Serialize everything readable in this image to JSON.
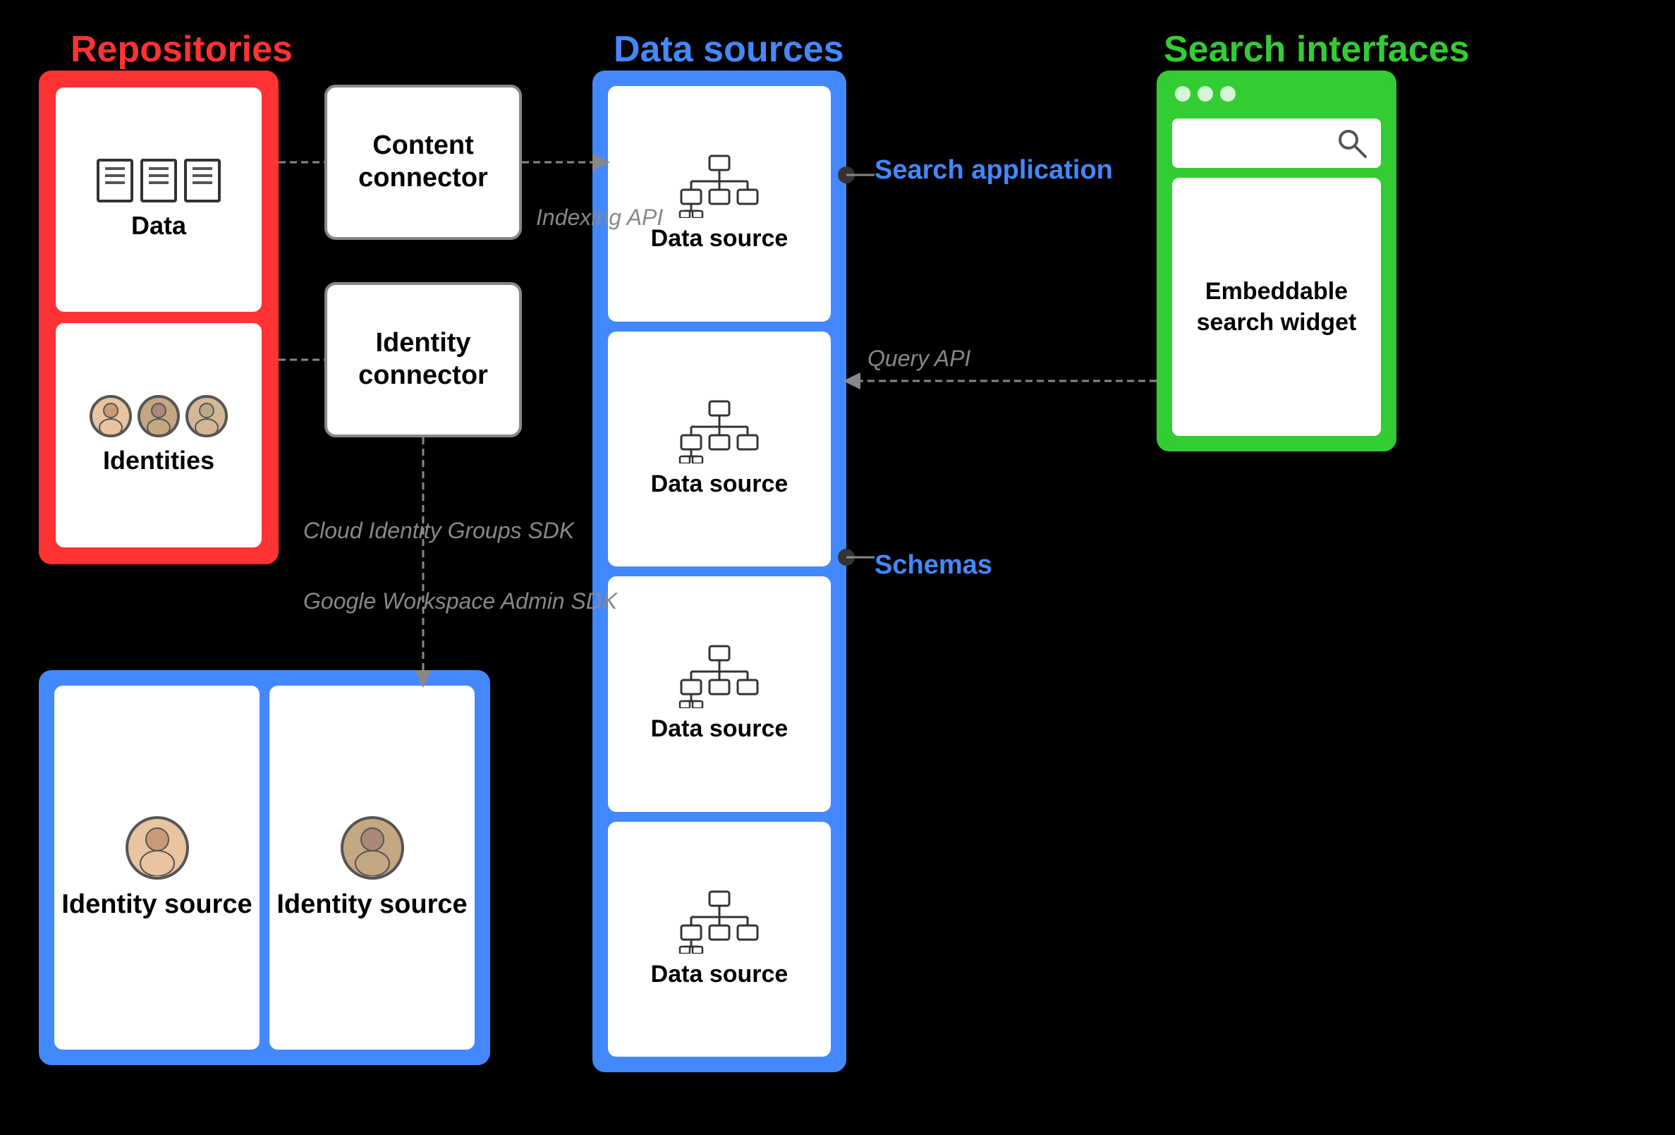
{
  "labels": {
    "repositories": "Repositories",
    "data_sources": "Data sources",
    "search_interfaces": "Search interfaces"
  },
  "repositories": {
    "data_box_label": "Data",
    "identities_box_label": "Identities"
  },
  "connectors": {
    "content_connector_label": "Content connector",
    "identity_connector_label": "Identity connector"
  },
  "data_sources": {
    "items": [
      {
        "label": "Data source"
      },
      {
        "label": "Data source"
      },
      {
        "label": "Data source"
      },
      {
        "label": "Data source"
      }
    ]
  },
  "identity_sources": {
    "items": [
      {
        "label": "Identity source"
      },
      {
        "label": "Identity source"
      }
    ]
  },
  "search_interfaces": {
    "search_input_placeholder": "Search",
    "embeddable_label": "Embeddable search widget"
  },
  "arrow_labels": {
    "indexing_api": "Indexing API",
    "cloud_identity": "Cloud Identity Groups SDK",
    "google_workspace": "Google Workspace Admin SDK",
    "query_api": "Query API",
    "schemas": "Schemas",
    "search_application": "Search application"
  }
}
